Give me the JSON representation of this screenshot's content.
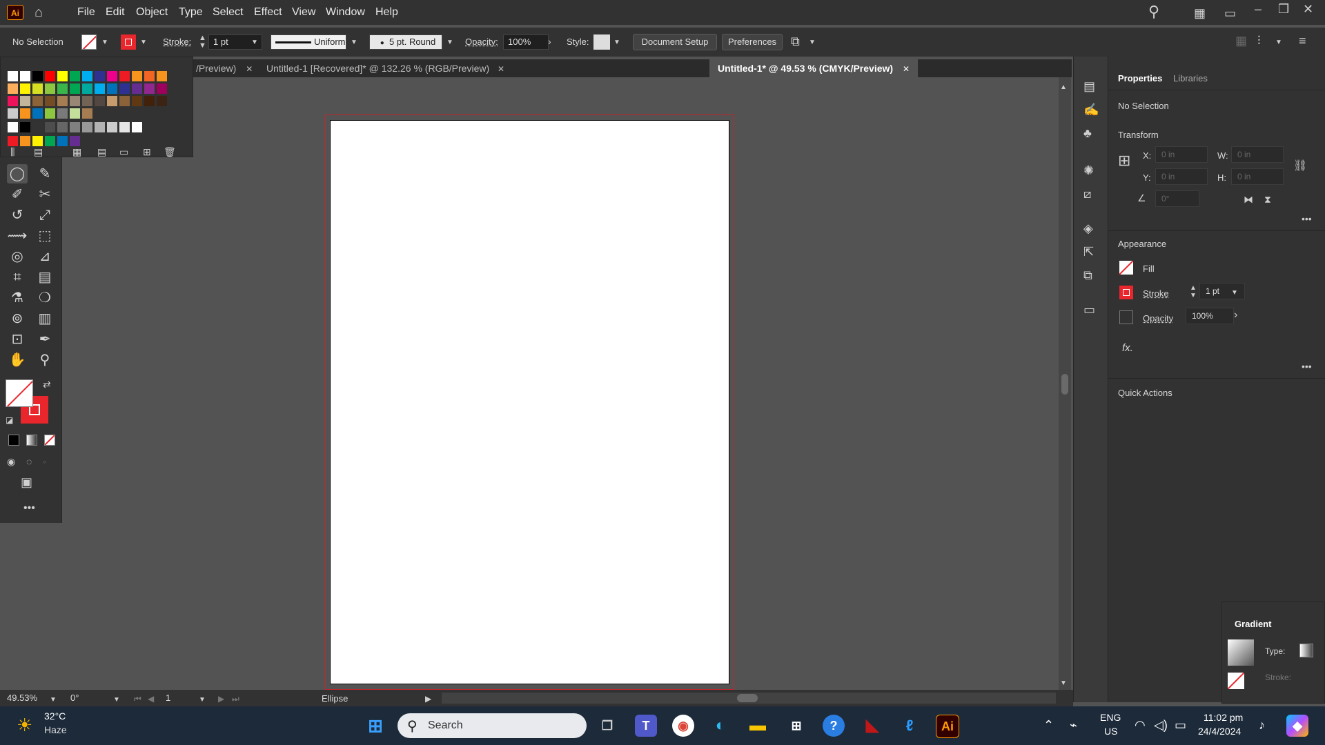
{
  "app": {
    "logo": "Ai"
  },
  "menu": [
    "File",
    "Edit",
    "Object",
    "Type",
    "Select",
    "Effect",
    "View",
    "Window",
    "Help"
  ],
  "control": {
    "selection": "No Selection",
    "stroke_label": "Stroke:",
    "stroke_value": "1 pt",
    "profile": "Uniform",
    "brush": "5 pt. Round",
    "opacity_label": "Opacity:",
    "opacity_value": "100%",
    "style_label": "Style:",
    "doc_setup": "Document Setup",
    "preferences": "Preferences"
  },
  "tabs": [
    {
      "label": "/Preview)",
      "active": false
    },
    {
      "label": "Untitled-1 [Recovered]* @ 132.26 % (RGB/Preview)",
      "active": false
    },
    {
      "label": "Untitled-1* @ 49.53 % (CMYK/Preview)",
      "active": true
    }
  ],
  "properties": {
    "tab_properties": "Properties",
    "tab_libraries": "Libraries",
    "selection": "No Selection",
    "transform": "Transform",
    "x_label": "X:",
    "x_value": "0 in",
    "y_label": "Y:",
    "y_value": "0 in",
    "w_label": "W:",
    "w_value": "0 in",
    "h_label": "H:",
    "h_value": "0 in",
    "angle_value": "0°",
    "appearance": "Appearance",
    "fill": "Fill",
    "stroke": "Stroke",
    "stroke_value": "1 pt",
    "opacity": "Opacity",
    "opacity_value": "100%",
    "fx": "fx.",
    "quick_actions": "Quick Actions"
  },
  "gradient": {
    "title": "Gradient",
    "type_label": "Type:",
    "stroke_label": "Stroke:"
  },
  "status": {
    "zoom": "49.53%",
    "rotate": "0°",
    "page": "1",
    "tool": "Ellipse"
  },
  "taskbar": {
    "temp": "32°C",
    "weather": "Haze",
    "search": "Search",
    "lang1": "ENG",
    "lang2": "US",
    "time": "11:02 pm",
    "date": "24/4/2024"
  },
  "colors": {
    "accent_red": "#e8262c",
    "ai_orange": "#ff9a00",
    "ui_dark": "#323232",
    "canvas": "#535353"
  }
}
